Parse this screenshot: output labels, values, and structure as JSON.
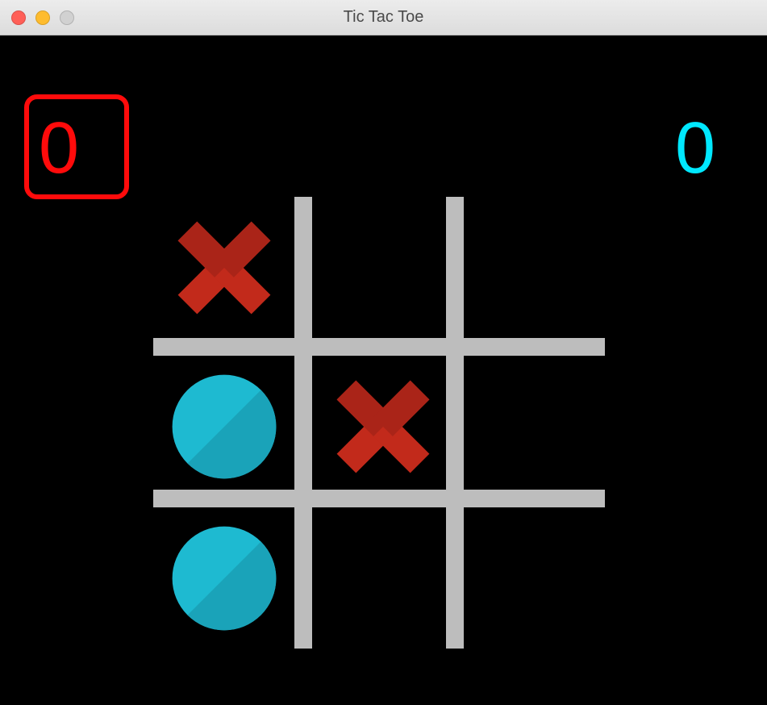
{
  "window": {
    "title": "Tic Tac Toe"
  },
  "score": {
    "x": "0",
    "o": "0",
    "active": "x"
  },
  "colors": {
    "x_primary": "#c22a1b",
    "x_shade": "#aa2418",
    "o_primary": "#1ebad1",
    "o_shade": "#1aa3b9",
    "grid": "#bdbdbd",
    "bg": "#000000",
    "score_x": "#ff0b0b",
    "score_o": "#00e8ff"
  },
  "board": [
    [
      "X",
      "",
      ""
    ],
    [
      "O",
      "X",
      ""
    ],
    [
      "O",
      "",
      ""
    ]
  ]
}
